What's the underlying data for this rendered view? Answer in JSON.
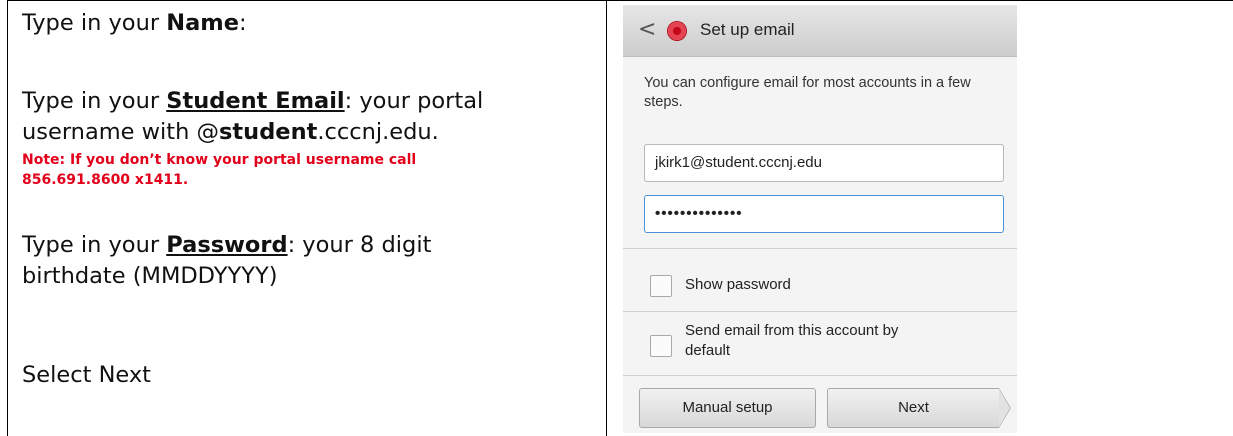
{
  "instructions": {
    "name": {
      "prefix": "Type in your ",
      "bold": "Name",
      "suffix": ":"
    },
    "email": {
      "prefix": "Type in your ",
      "bold": "Student Email",
      "suffix": ": your portal",
      "line2_prefix": "username with @",
      "line2_bold": "student",
      "line2_suffix": ".cccnj.edu."
    },
    "note_line1": "Note: If you don’t know your portal username call",
    "note_line2": "856.691.8600 x1411.",
    "password": {
      "prefix": "Type in your ",
      "bold": "Password",
      "suffix": ": your 8 digit",
      "line2": "birthdate (MMDDYYYY)"
    },
    "select_next": "Select Next"
  },
  "phone": {
    "back_icon": "<",
    "app_icon": "email-app-icon",
    "header_title": "Set up email",
    "intro": "You can configure email for most accounts in a few steps.",
    "email_value": "jkirk1@student.cccnj.edu",
    "password_value": "••••••••••••••",
    "show_password_label": "Show password",
    "send_default_label": "Send email from this account by default",
    "manual_setup_label": "Manual setup",
    "next_label": "Next"
  }
}
